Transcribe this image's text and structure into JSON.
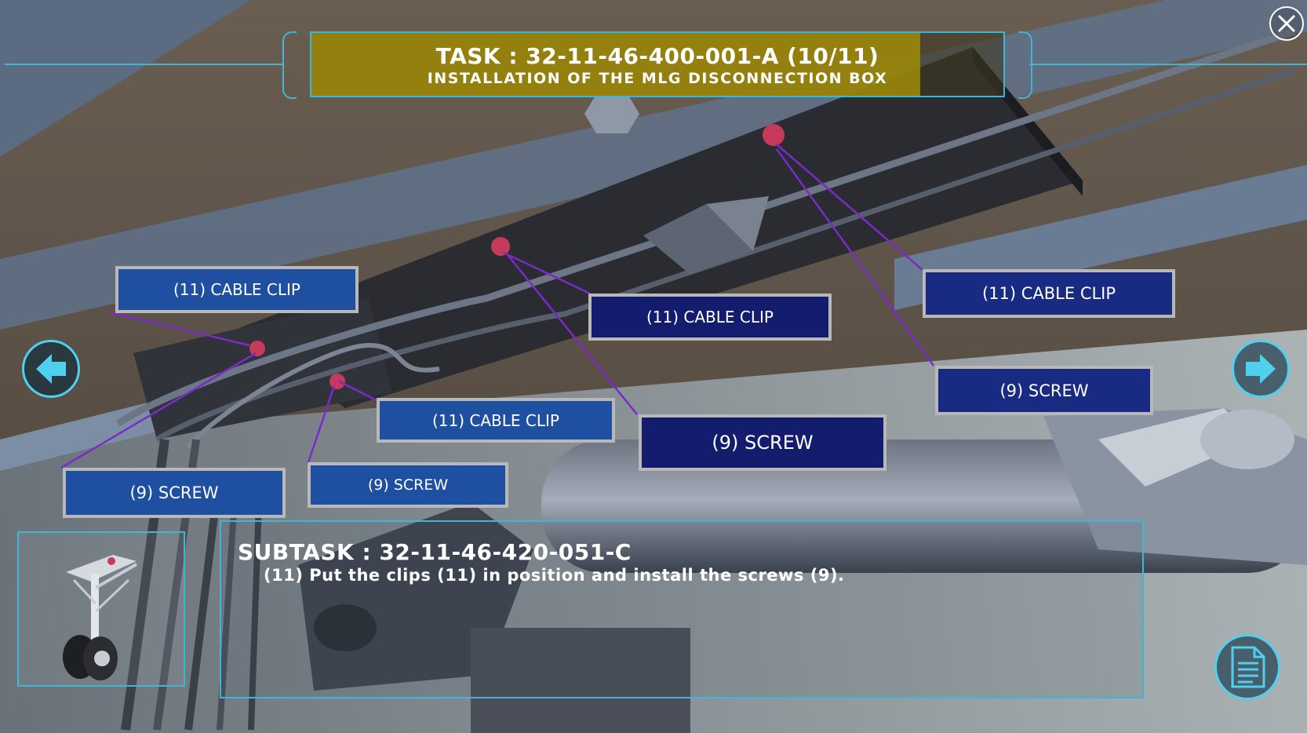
{
  "task": {
    "title": "TASK : 32-11-46-400-001-A (10/11)",
    "subtitle": "INSTALLATION OF THE MLG DISCONNECTION BOX"
  },
  "controls": {
    "close_icon": "close-icon",
    "prev_icon": "arrow-left-icon",
    "next_icon": "arrow-right-icon",
    "doc_icon": "document-icon"
  },
  "labels": {
    "clip_1": "(11) CABLE CLIP",
    "clip_2": "(11) CABLE CLIP",
    "clip_3": "(11) CABLE CLIP",
    "clip_4": "(11) CABLE CLIP",
    "screw_1": "(9) SCREW",
    "screw_2": "(9) SCREW",
    "screw_3": "(9) SCREW",
    "screw_4": "(9) SCREW"
  },
  "subtask": {
    "title": "SUBTASK : 32-11-46-420-051-C",
    "instruction": "(11) Put the clips (11) in position and install the screws (9)."
  },
  "colors": {
    "accent": "#3fb6d6",
    "header_bg": "#96820a",
    "label_blue": "#1e4fa0",
    "label_navy": "#182a82",
    "leader_line": "#7a2bc8"
  }
}
